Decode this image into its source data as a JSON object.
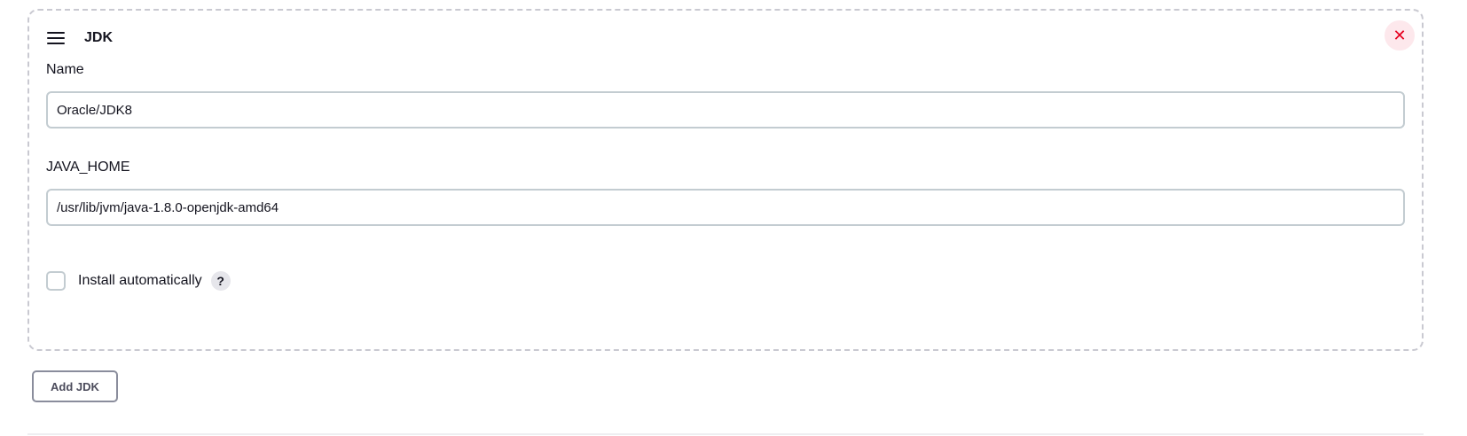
{
  "jdk_block": {
    "title": "JDK",
    "icons": {
      "drag": "drag-handle-icon",
      "delete": "close-icon",
      "help": "help-icon"
    },
    "delete_symbol": "✕",
    "name_field": {
      "label": "Name",
      "value": "Oracle/JDK8"
    },
    "java_home_field": {
      "label": "JAVA_HOME",
      "value": "/usr/lib/jvm/java-1.8.0-openjdk-amd64"
    },
    "install_automatically": {
      "label": "Install automatically",
      "checked": false,
      "help_symbol": "?"
    }
  },
  "add_button_label": "Add JDK",
  "colors": {
    "delete_accent": "#e6001f",
    "delete_background": "#fde8ec",
    "field_border": "#c3ccd1",
    "dashed_border": "#c9c9d1"
  }
}
